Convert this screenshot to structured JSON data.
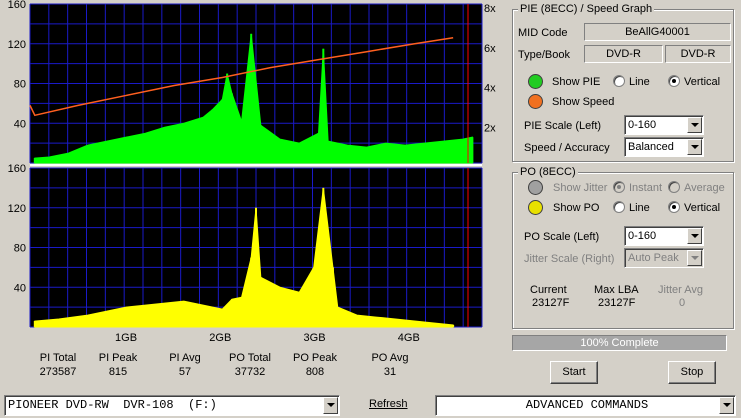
{
  "graph": {
    "pie_y_ticks": [
      "160",
      "120",
      "80",
      "40"
    ],
    "speed_ticks": [
      "8x",
      "6x",
      "4x",
      "2x"
    ],
    "po_y_ticks": [
      "160",
      "120",
      "80",
      "40"
    ],
    "x_ticks": [
      "1GB",
      "2GB",
      "3GB",
      "4GB"
    ]
  },
  "chart_data": [
    {
      "type": "area",
      "name": "PIE (8ECC)",
      "xlabel": "",
      "ylabel": "",
      "ylim": [
        0,
        160
      ],
      "xlim_gb": [
        0,
        4.7
      ],
      "series": [
        {
          "name": "PIE",
          "color": "#00ff00",
          "x": [
            0.05,
            0.2,
            0.4,
            0.6,
            0.8,
            1.0,
            1.2,
            1.4,
            1.6,
            1.8,
            1.9,
            2.0,
            2.05,
            2.1,
            2.2,
            2.3,
            2.4,
            2.6,
            2.8,
            3.0,
            3.05,
            3.1,
            3.3,
            3.5,
            3.7,
            3.9,
            4.1,
            4.3,
            4.5,
            4.6
          ],
          "y": [
            5,
            6,
            10,
            18,
            22,
            26,
            30,
            36,
            40,
            46,
            54,
            64,
            90,
            70,
            42,
            130,
            38,
            24,
            20,
            30,
            115,
            22,
            18,
            16,
            20,
            18,
            20,
            22,
            24,
            26
          ]
        },
        {
          "name": "Speed",
          "color": "#ff6020",
          "unit": "x",
          "x": [
            0.0,
            0.05,
            0.5,
            1.0,
            1.5,
            2.0,
            2.5,
            3.0,
            3.5,
            4.0,
            4.4
          ],
          "y": [
            2.9,
            2.4,
            2.9,
            3.4,
            3.9,
            4.3,
            4.8,
            5.2,
            5.6,
            6.0,
            6.3
          ]
        }
      ]
    },
    {
      "type": "bar",
      "name": "PO (8ECC)",
      "xlabel": "",
      "ylabel": "",
      "ylim": [
        0,
        160
      ],
      "xlim_gb": [
        0,
        4.7
      ],
      "series": [
        {
          "name": "PO",
          "color": "#ffff00",
          "x": [
            0.05,
            0.3,
            0.6,
            0.8,
            1.0,
            1.2,
            1.4,
            1.6,
            1.8,
            2.0,
            2.1,
            2.2,
            2.3,
            2.35,
            2.4,
            2.6,
            2.8,
            2.95,
            3.05,
            3.15,
            3.2,
            3.4,
            3.6,
            3.8,
            4.0,
            4.2,
            4.4
          ],
          "y": [
            6,
            8,
            12,
            16,
            20,
            22,
            24,
            26,
            22,
            18,
            28,
            30,
            70,
            120,
            50,
            40,
            35,
            60,
            140,
            60,
            20,
            12,
            10,
            8,
            6,
            4,
            2
          ]
        }
      ]
    }
  ],
  "stats": [
    {
      "label": "PI Total",
      "value": "273587"
    },
    {
      "label": "PI Peak",
      "value": "815"
    },
    {
      "label": "PI Avg",
      "value": "57"
    },
    {
      "label": "PO Total",
      "value": "37732"
    },
    {
      "label": "PO Peak",
      "value": "808"
    },
    {
      "label": "PO Avg",
      "value": "31"
    }
  ],
  "pie_panel": {
    "title": "PIE (8ECC) / Speed Graph",
    "mid_code_label": "MID Code",
    "mid_code": "BeAllG40001",
    "type_book_label": "Type/Book",
    "type": "DVD-R",
    "book": "DVD-R",
    "show_pie": "Show PIE",
    "line": "Line",
    "vertical": "Vertical",
    "show_speed": "Show Speed",
    "pie_scale_label": "PIE Scale (Left)",
    "pie_scale": "0-160",
    "speed_accuracy_label": "Speed / Accuracy",
    "speed_accuracy": "Balanced",
    "pie_color": "#22cc22",
    "speed_color": "#f07020"
  },
  "po_panel": {
    "title": "PO (8ECC)",
    "show_jitter": "Show Jitter",
    "instant": "Instant",
    "average": "Average",
    "show_po": "Show PO",
    "line": "Line",
    "vertical": "Vertical",
    "po_scale_label": "PO Scale (Left)",
    "po_scale": "0-160",
    "jitter_scale_label": "Jitter Scale (Right)",
    "jitter_scale": "Auto Peak",
    "current_label": "Current",
    "current": "23127F",
    "max_lba_label": "Max LBA",
    "max_lba": "23127F",
    "jitter_avg_label": "Jitter Avg",
    "jitter_avg": "0",
    "jitter_color": "#a0a0a0",
    "po_color": "#e8e000"
  },
  "progress": {
    "text": "100% Complete",
    "fraction": 1.0
  },
  "buttons": {
    "start": "Start",
    "stop": "Stop",
    "refresh": "Refresh"
  },
  "drive": {
    "value": "PIONEER DVD-RW  DVR-108  (F:)"
  },
  "commands": {
    "value": "ADVANCED COMMANDS"
  }
}
